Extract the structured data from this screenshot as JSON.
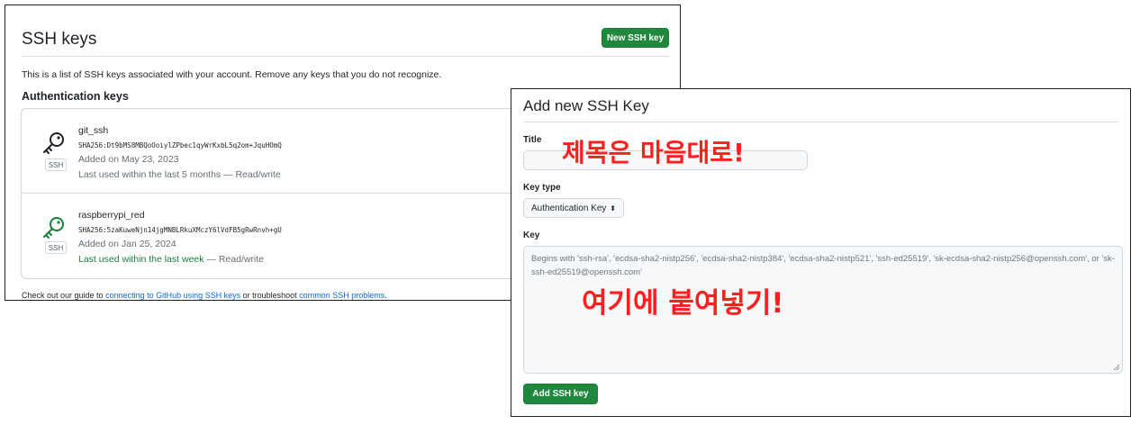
{
  "ssh_keys_page": {
    "title": "SSH keys",
    "new_key_button": "New SSH key",
    "description": "This is a list of SSH keys associated with your account. Remove any keys that you do not recognize.",
    "auth_heading": "Authentication keys",
    "keys": [
      {
        "badge": "SSH",
        "name": "git_ssh",
        "fingerprint": "SHA256:Dt9bMS8MBQoOoiylZPbec1qyWrKxbL5q2om+JquHOmQ",
        "added": "Added on May 23, 2023",
        "last_used": "Last used within the last 5 months",
        "access": "— Read/write"
      },
      {
        "badge": "SSH",
        "name": "raspberrypi_red",
        "fingerprint": "SHA256:5zaKuweNjn14jgMNBLRkuXMczY6lVdFB5gRwRnvh+gU",
        "added": "Added on Jan 25, 2024",
        "last_used": "Last used within the last week",
        "access": "— Read/write"
      }
    ],
    "footer": {
      "prefix": "Check out our guide to ",
      "link1": "connecting to GitHub using SSH keys",
      "middle": " or troubleshoot ",
      "link2": "common SSH problems",
      "suffix": "."
    }
  },
  "add_key_form": {
    "title": "Add new SSH Key",
    "title_label": "Title",
    "title_value": "",
    "key_type_label": "Key type",
    "key_type_selected": "Authentication Key",
    "key_label": "Key",
    "key_placeholder": "Begins with 'ssh-rsa', 'ecdsa-sha2-nistp256', 'ecdsa-sha2-nistp384', 'ecdsa-sha2-nistp521', 'ssh-ed25519', 'sk-ecdsa-sha2-nistp256@openssh.com', or 'sk-ssh-ed25519@openssh.com'",
    "submit_button": "Add SSH key"
  },
  "annotations": {
    "title_hint": "제목은 마음대로!",
    "key_hint": "여기에 붙여넣기!"
  },
  "colors": {
    "primary_button": "#1f883d",
    "link": "#0969da",
    "recent_use": "#1a7f37",
    "annotation": "#ff1f1f"
  }
}
